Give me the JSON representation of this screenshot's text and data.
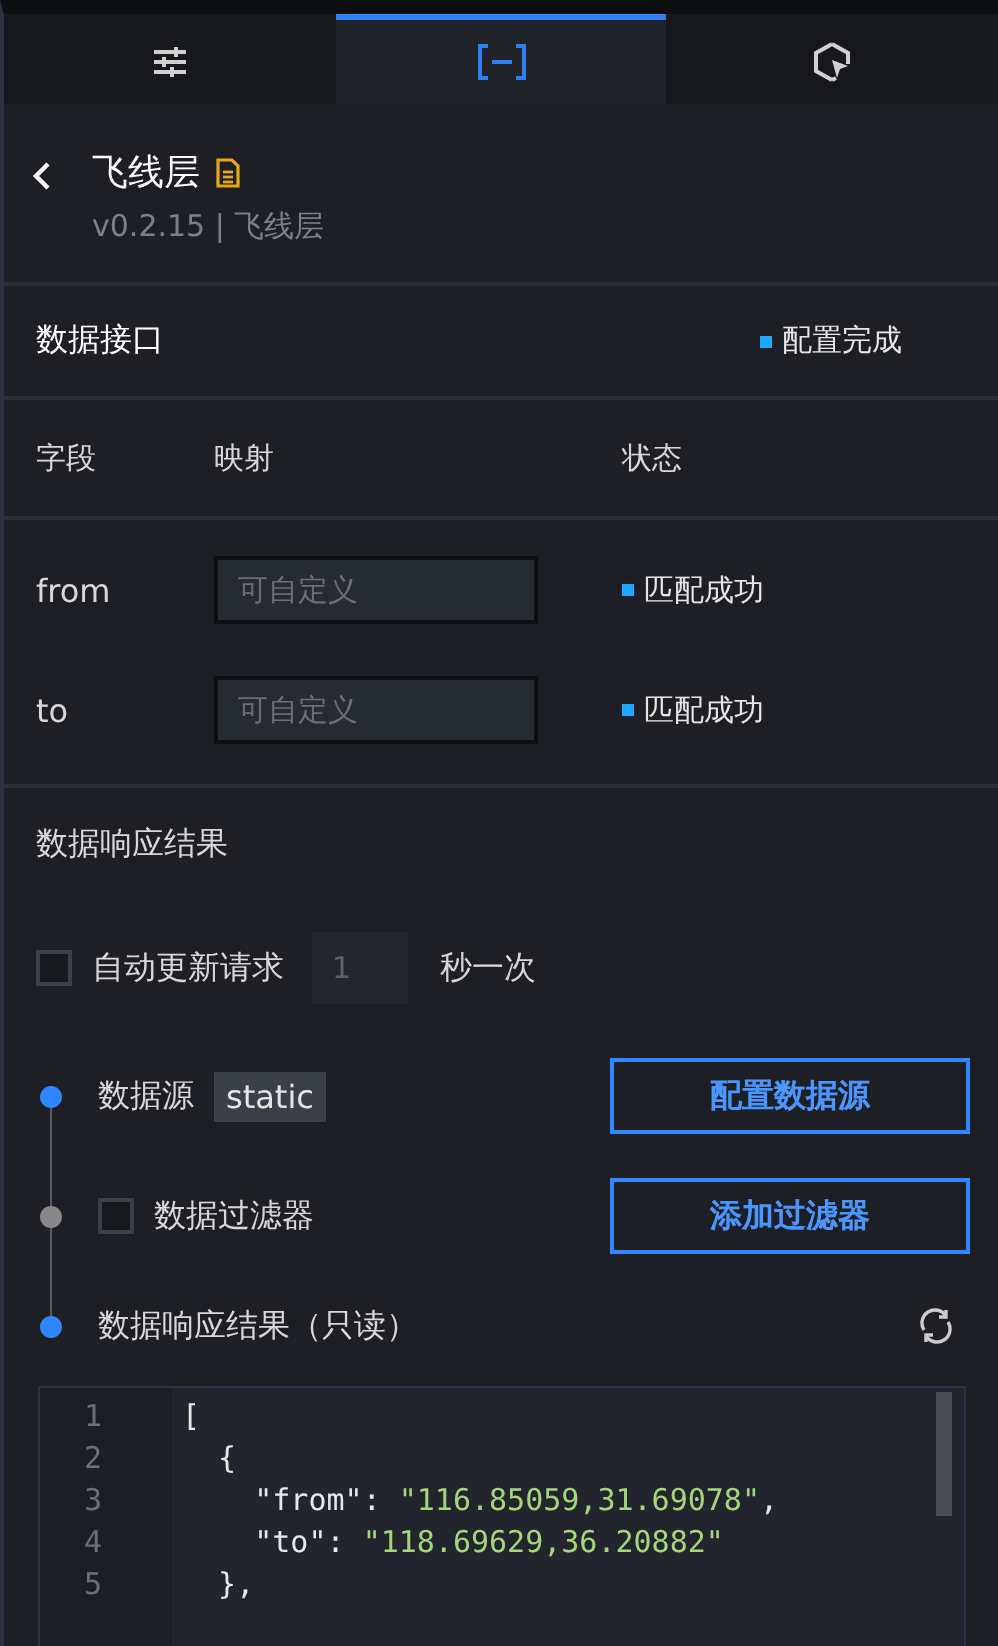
{
  "tabs": [
    {
      "selected": false
    },
    {
      "selected": true
    },
    {
      "selected": false
    }
  ],
  "header": {
    "title": "飞线层",
    "subtitle": "v0.2.15 | 飞线层"
  },
  "interface": {
    "title": "数据接口",
    "status": "配置完成",
    "columns": [
      "字段",
      "映射",
      "状态"
    ],
    "rows": [
      {
        "field": "from",
        "placeholder": "可自定义",
        "status": "匹配成功"
      },
      {
        "field": "to",
        "placeholder": "可自定义",
        "status": "匹配成功"
      }
    ]
  },
  "response": {
    "title": "数据响应结果",
    "auto_update": {
      "label": "自动更新请求",
      "checked": false,
      "placeholder": "1",
      "unit": "秒一次"
    },
    "steps": [
      {
        "kind": "source",
        "active": true,
        "label": "数据源",
        "tag": "static",
        "button": "配置数据源"
      },
      {
        "kind": "filter",
        "active": false,
        "label": "数据过滤器",
        "checked": false,
        "button": "添加过滤器"
      },
      {
        "kind": "result",
        "active": true,
        "label": "数据响应结果（只读）"
      }
    ],
    "code": [
      [
        {
          "kind": "punct",
          "text": "["
        }
      ],
      [
        {
          "kind": "punct",
          "text": "  {"
        }
      ],
      [
        {
          "kind": "key",
          "text": "    \"from\""
        },
        {
          "kind": "punct",
          "text": ": "
        },
        {
          "kind": "string",
          "text": "\"116.85059,31.69078\""
        },
        {
          "kind": "punct",
          "text": ","
        }
      ],
      [
        {
          "kind": "key",
          "text": "    \"to\""
        },
        {
          "kind": "punct",
          "text": ": "
        },
        {
          "kind": "string",
          "text": "\"118.69629,36.20882\""
        }
      ],
      [
        {
          "kind": "punct",
          "text": "  },"
        }
      ]
    ],
    "line_numbers": [
      "1",
      "2",
      "3",
      "4",
      "5"
    ]
  }
}
